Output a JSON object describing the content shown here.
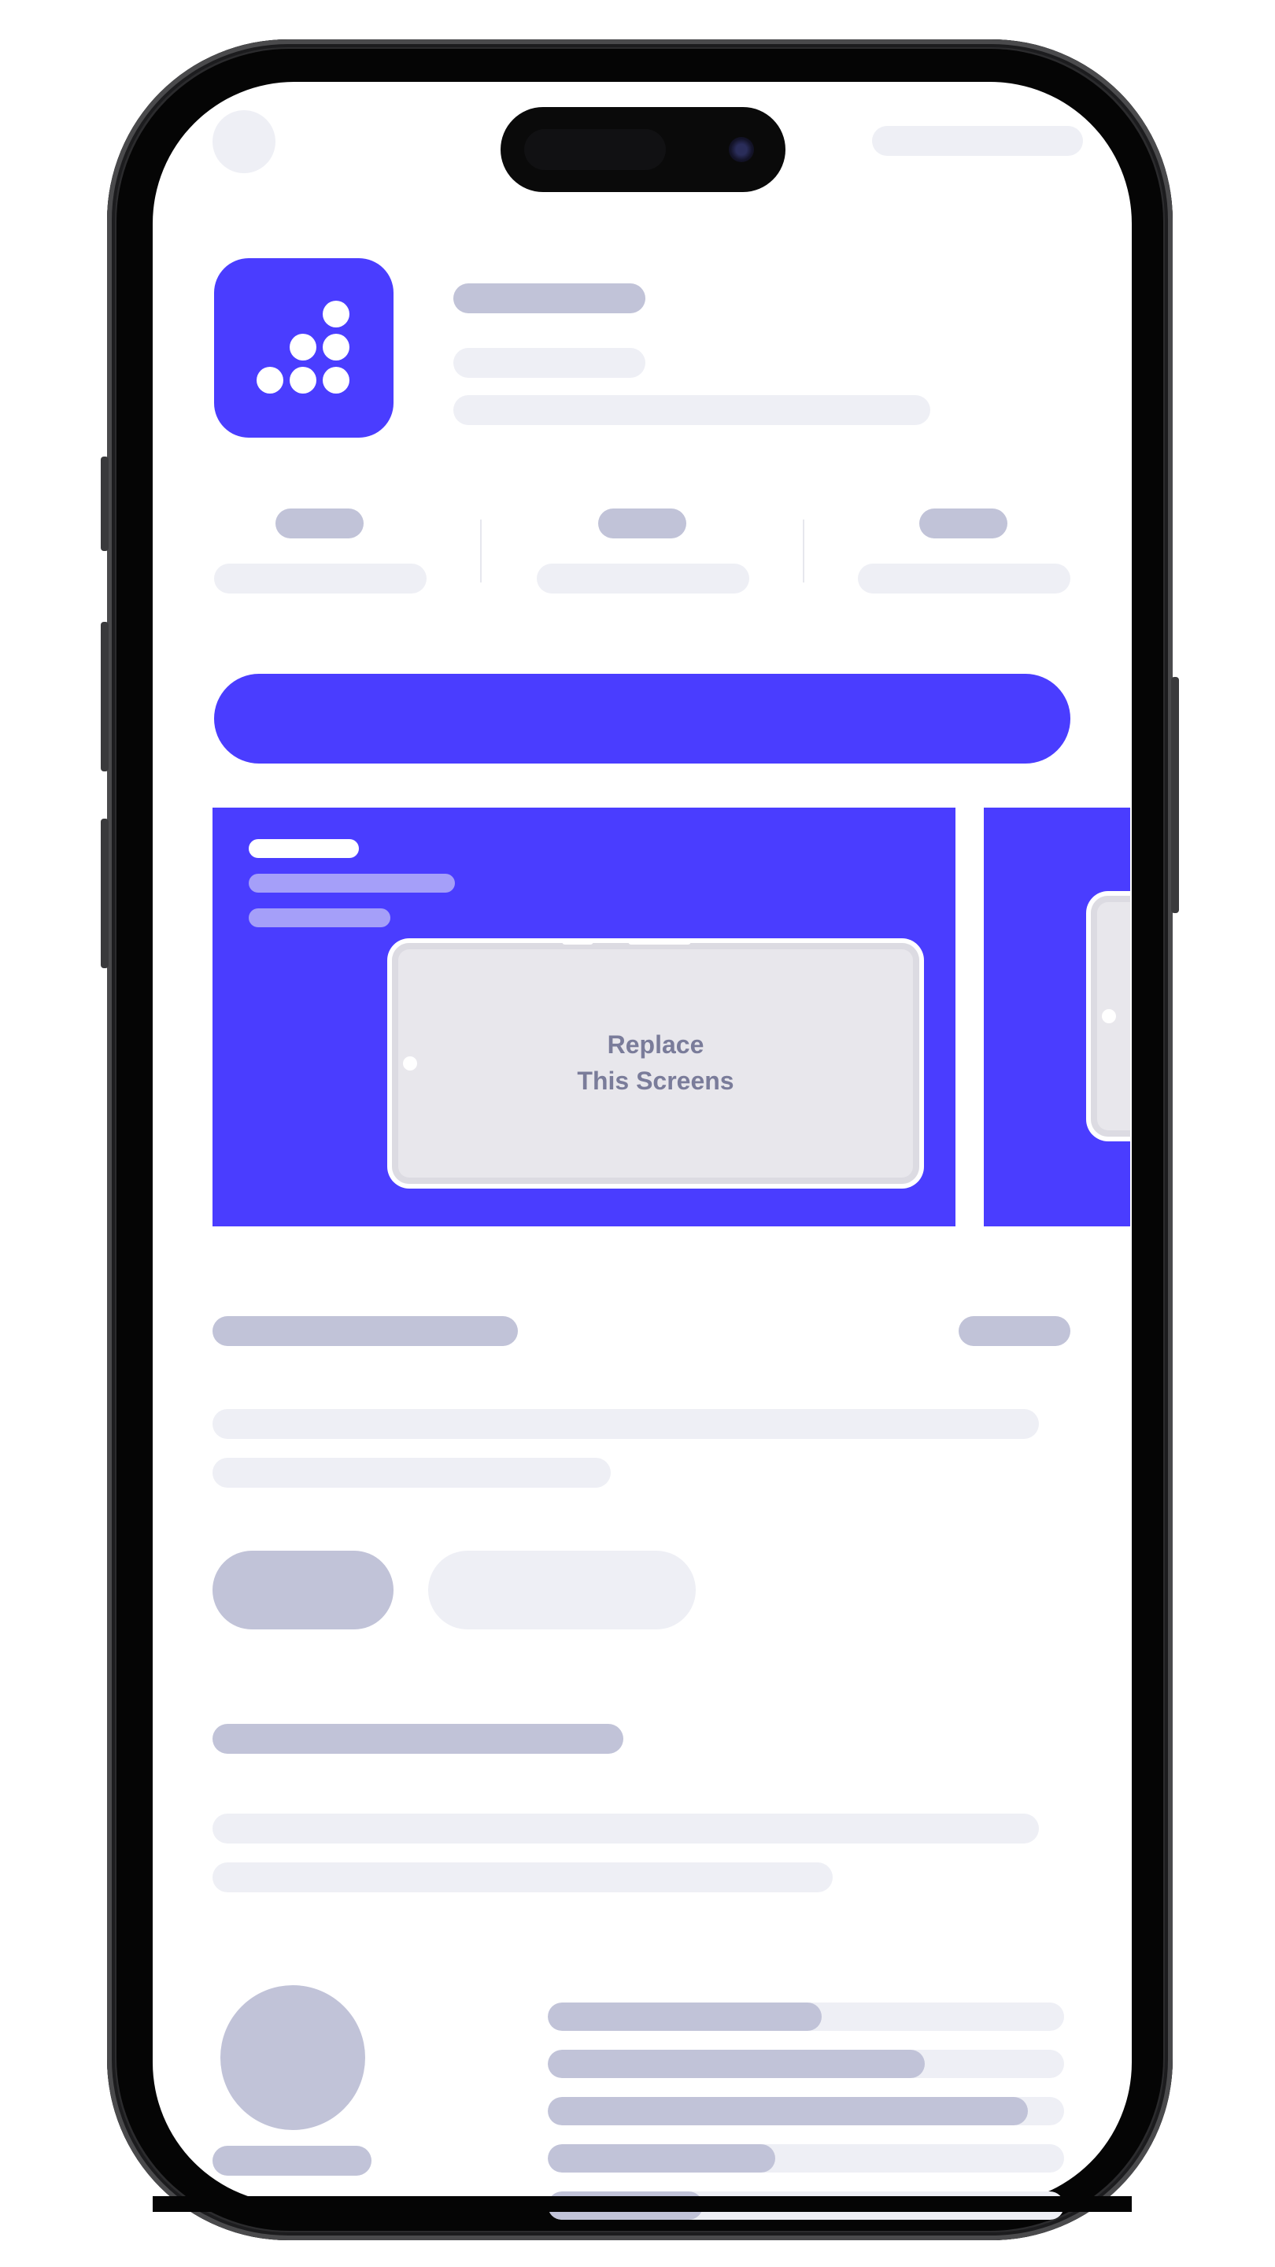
{
  "screenshot": {
    "placeholder_line1": "Replace",
    "placeholder_line2": "This Screens"
  },
  "colors": {
    "accent": "#4a3dff",
    "skeleton_dark": "#c1c3d8",
    "skeleton_light": "#eeeff5",
    "placeholder_text": "#7a7c9a"
  },
  "icons": {
    "app_icon": "dot-grid-icon",
    "top_left": "avatar-placeholder"
  },
  "ratings": {
    "bar_fill_fractions": [
      0.53,
      0.73,
      0.93,
      0.44,
      0.3
    ]
  }
}
